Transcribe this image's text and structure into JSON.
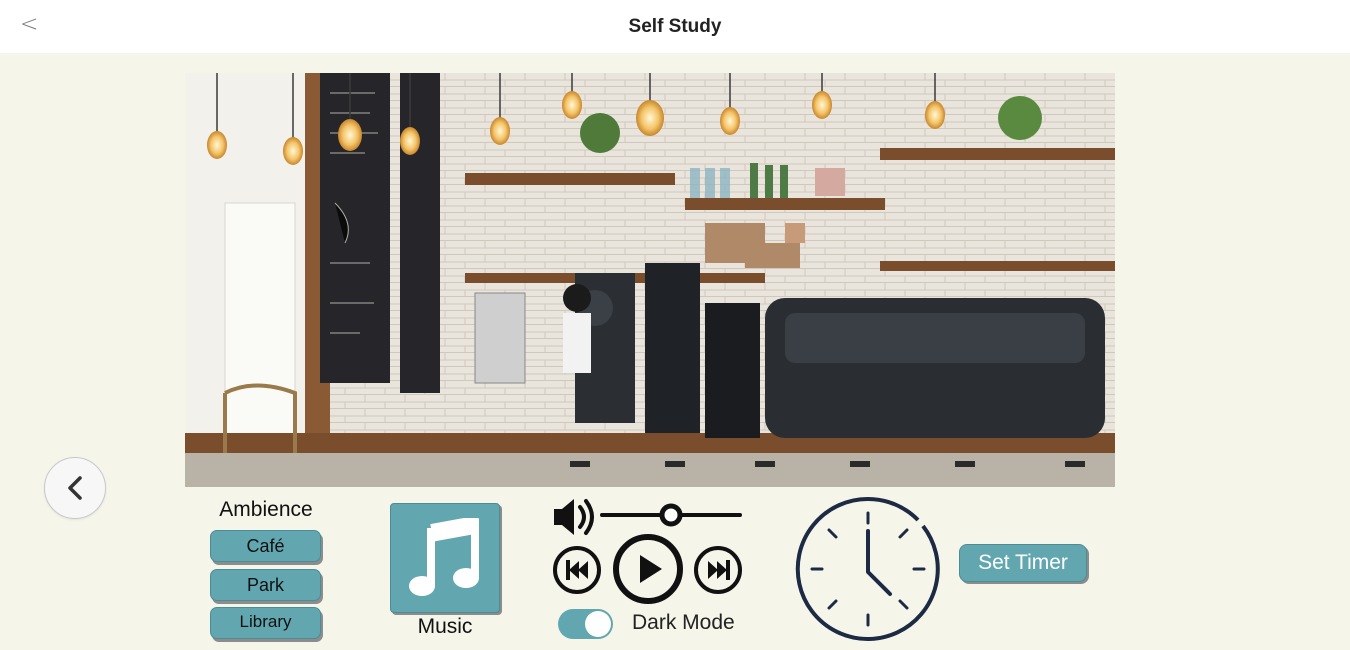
{
  "header": {
    "back_glyph": "<",
    "title": "Self Study"
  },
  "scene": {
    "description_icon": "cafe-scene-image"
  },
  "ambience": {
    "title": "Ambience",
    "options": [
      "Café",
      "Park",
      "Library"
    ]
  },
  "music": {
    "label": "Music",
    "icon": "music-note-icon"
  },
  "player": {
    "volume": 0.5,
    "dark_mode_label": "Dark Mode",
    "dark_mode_on": true
  },
  "timer": {
    "button_label": "Set Timer",
    "icon": "clock-icon"
  },
  "colors": {
    "accent": "#62a7b0",
    "background": "#f5f5ea",
    "clock_stroke": "#1d2a44"
  }
}
